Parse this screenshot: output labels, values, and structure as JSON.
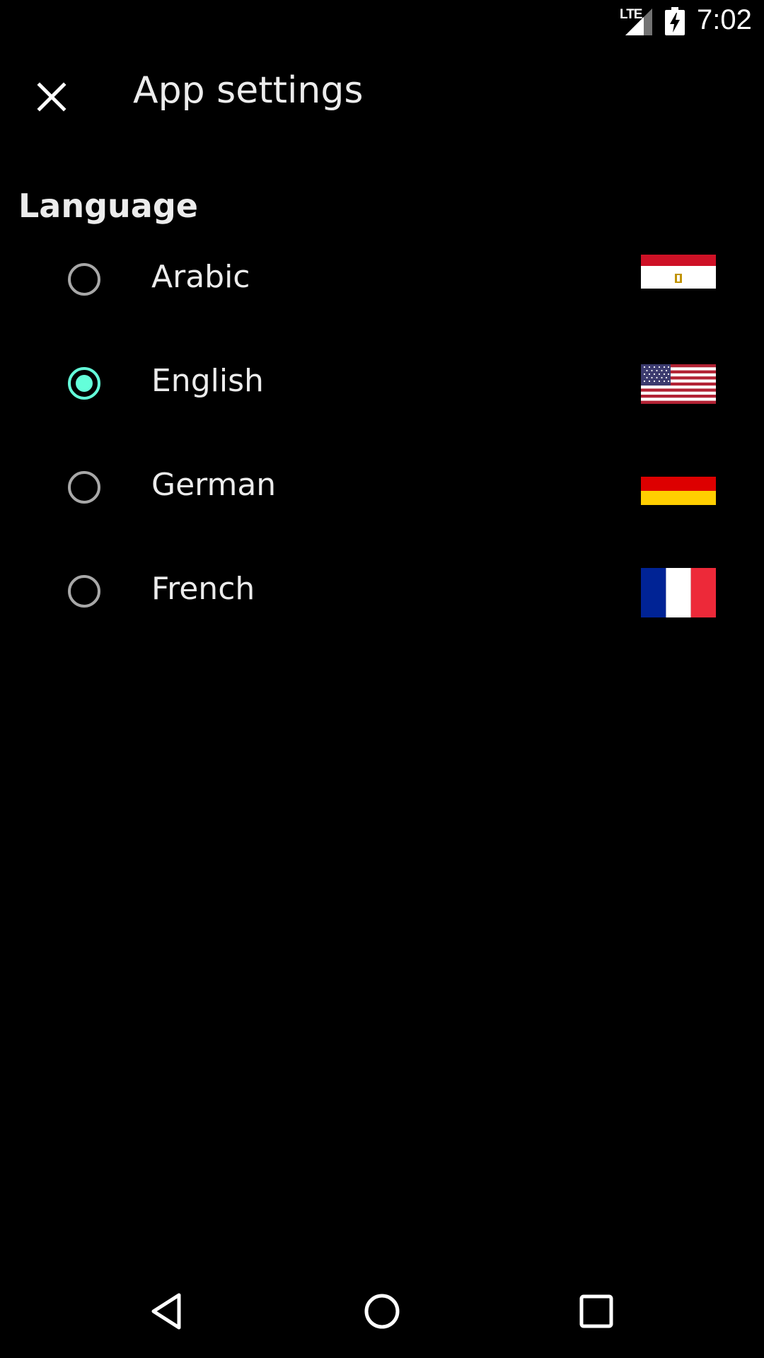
{
  "status_bar": {
    "network": "LTE",
    "time": "7:02",
    "icons": [
      "signal-icon",
      "battery-charging-icon"
    ]
  },
  "toolbar": {
    "close_icon": "close-icon",
    "title": "App settings"
  },
  "language_section": {
    "header": "Language",
    "selected": "English",
    "options": [
      {
        "label": "Arabic",
        "flag": "egypt-flag-icon",
        "selected": false
      },
      {
        "label": "English",
        "flag": "usa-flag-icon",
        "selected": true
      },
      {
        "label": "German",
        "flag": "germany-flag-icon",
        "selected": false
      },
      {
        "label": "French",
        "flag": "france-flag-icon",
        "selected": false
      }
    ]
  },
  "nav_bar": {
    "icons": [
      "back-icon",
      "home-icon",
      "recents-icon"
    ]
  },
  "colors": {
    "background": "#000000",
    "text": "#ececec",
    "accent": "#64ffda",
    "radio_unchecked": "#a8a8a8"
  }
}
